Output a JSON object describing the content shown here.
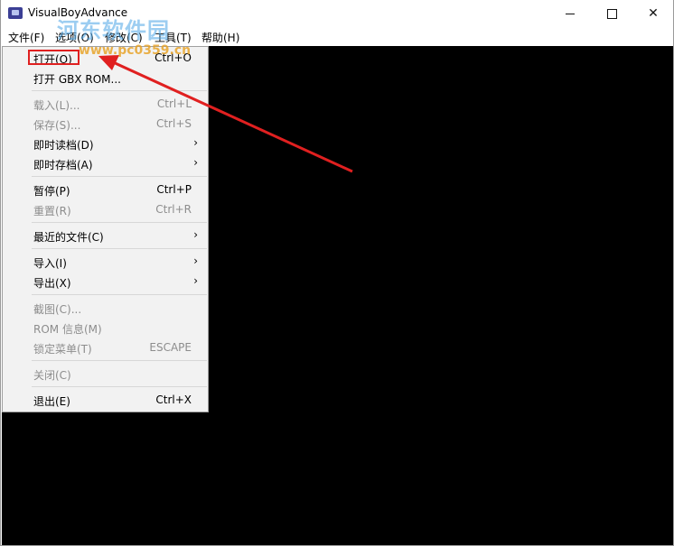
{
  "window": {
    "title": "VisualBoyAdvance",
    "controls": {
      "minimize_icon": "minimize-icon",
      "maximize_icon": "maximize-icon",
      "close_glyph": "✕"
    }
  },
  "menubar": {
    "items": [
      {
        "label": "文件(F)"
      },
      {
        "label": "选项(O)"
      },
      {
        "label": "修改(C)"
      },
      {
        "label": "工具(T)"
      },
      {
        "label": "帮助(H)"
      }
    ]
  },
  "file_menu": {
    "items": [
      {
        "label": "打开(O)",
        "shortcut": "Ctrl+O",
        "enabled": true
      },
      {
        "label": "打开 GBX ROM...",
        "shortcut": "",
        "enabled": true
      },
      {
        "label": "载入(L)...",
        "shortcut": "Ctrl+L",
        "enabled": false
      },
      {
        "label": "保存(S)...",
        "shortcut": "Ctrl+S",
        "enabled": false
      },
      {
        "label": "即时读档(D)",
        "submenu": true,
        "enabled": true
      },
      {
        "label": "即时存档(A)",
        "submenu": true,
        "enabled": true
      },
      {
        "label": "暂停(P)",
        "shortcut": "Ctrl+P",
        "enabled": true
      },
      {
        "label": "重置(R)",
        "shortcut": "Ctrl+R",
        "enabled": false
      },
      {
        "label": "最近的文件(C)",
        "submenu": true,
        "enabled": true
      },
      {
        "label": "导入(I)",
        "submenu": true,
        "enabled": true
      },
      {
        "label": "导出(X)",
        "submenu": true,
        "enabled": true
      },
      {
        "label": "截图(C)...",
        "shortcut": "",
        "enabled": false
      },
      {
        "label": "ROM 信息(M)",
        "shortcut": "",
        "enabled": false
      },
      {
        "label": "锁定菜单(T)",
        "shortcut": "ESCAPE",
        "enabled": false
      },
      {
        "label": "关闭(C)",
        "shortcut": "",
        "enabled": false
      },
      {
        "label": "退出(E)",
        "shortcut": "Ctrl+X",
        "enabled": true
      }
    ],
    "submenu_arrow": "›"
  },
  "watermark": {
    "text": "河东软件园",
    "url": "www.pc0359.cn"
  },
  "annotation": {
    "color": "#e02020"
  },
  "colors": {
    "canvas": "#000000",
    "menu_bg": "#f2f2f2",
    "disabled_text": "#8d8d8d"
  }
}
